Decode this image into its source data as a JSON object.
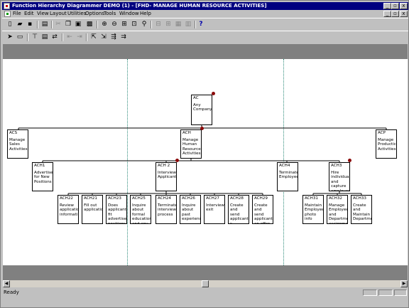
{
  "window": {
    "title": "Function Hierarchy Diagrammer DEMO (1) - [FHD- MANAGE HUMAN RESOURCE ACTIVITIES]"
  },
  "title_buttons": [
    "_",
    "▫",
    "x"
  ],
  "mdi_buttons": [
    "_",
    "▫",
    "x"
  ],
  "menu": [
    "File",
    "Edit",
    "View",
    "Layout",
    "Utilities",
    "Options",
    "Tools",
    "Window",
    "Help"
  ],
  "toolbar1": [
    "new-icon",
    "open-icon",
    "save-icon",
    "print-icon",
    "cut-icon",
    "copy-icon",
    "paste-icon",
    "properties-icon",
    "zoom-in-icon",
    "zoom-out-icon",
    "zoom-fit-icon",
    "zoom-select-icon",
    "find-icon",
    "collapse-icon",
    "expand-icon",
    "layout-icon",
    "refresh-icon",
    "help-icon"
  ],
  "toolbar2": [
    "pointer-icon",
    "rectangle-icon",
    "hierarchy-icon",
    "align-icon",
    "move-icon",
    "resequence-icon",
    "arrange-icon",
    "promote-icon",
    "demote-icon",
    "arrange-left-icon",
    "arrange-right-icon"
  ],
  "nodes": {
    "root": {
      "id": "AC",
      "label": "Any Company"
    },
    "acs": {
      "id": "ACS",
      "label": "Manage Sales Activities"
    },
    "ach": {
      "id": "ACH",
      "label": "Manage Human Resource Activities"
    },
    "acp": {
      "id": "ACP",
      "label": "Manage Productic Activities"
    },
    "ach1": {
      "id": "ACH1",
      "label": "Advertise for New Positions"
    },
    "ach2": {
      "id": "ACH 2",
      "label": "Interview Applicant"
    },
    "ach4": {
      "id": "ACH4",
      "label": "Terminate Employee"
    },
    "ach3": {
      "id": "ACH3",
      "label": "Hire individua and capture employee"
    },
    "ach22": {
      "id": "ACH22",
      "label": "Review applicatic informati"
    },
    "ach21": {
      "id": "ACH21",
      "label": "Fill out applicatic"
    },
    "ach23": {
      "id": "ACH23",
      "label": "Does applicant fit advertise positions"
    },
    "ach25": {
      "id": "ACH25",
      "label": "Inquire about formal education and any"
    },
    "ach24": {
      "id": "ACH24",
      "label": "Terminate interview process"
    },
    "ach26": {
      "id": "ACH26",
      "label": "Inquire about past experienc"
    },
    "ach27": {
      "id": "ACH27",
      "label": "Interview exit"
    },
    "ach28": {
      "id": "ACH28",
      "label": "Create and send applicant s rejection"
    },
    "ach29": {
      "id": "ACH29",
      "label": "Create and send applicant an offer"
    },
    "ach31": {
      "id": "ACH31",
      "label": "Maintain Employee photo info"
    },
    "ach32": {
      "id": "ACH32",
      "label": "Manage Employee and Departme assignments"
    },
    "ach33": {
      "id": "ACH33",
      "label": "Create and Maintain Departme"
    }
  },
  "status": {
    "text": "Ready"
  }
}
